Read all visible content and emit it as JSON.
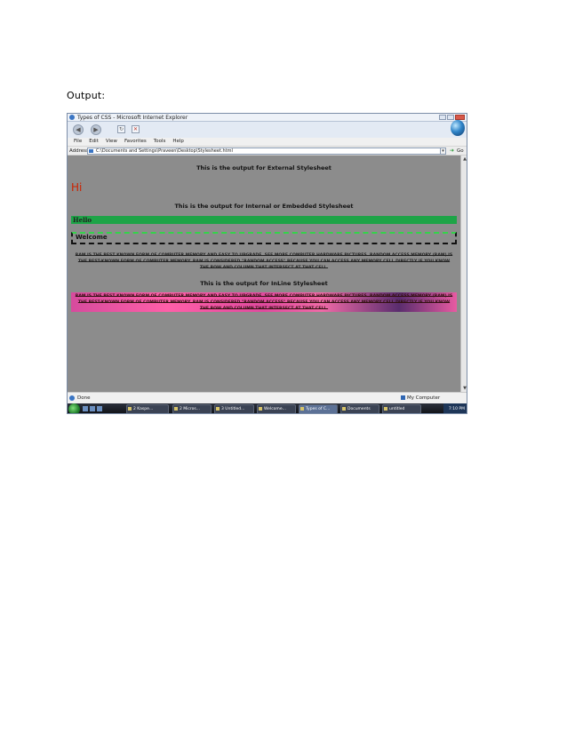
{
  "caption": "Output:",
  "window": {
    "title": "Types of CSS - Microsoft Internet Explorer"
  },
  "menu": [
    "File",
    "Edit",
    "View",
    "Favorites",
    "Tools",
    "Help"
  ],
  "address": {
    "label": "Address",
    "value": "C:\\Documents and Settings\\Praveen\\Desktop\\Stylesheet.html",
    "go": "Go"
  },
  "page": {
    "external_heading": "This is the output for External Stylesheet",
    "hi": "Hi",
    "internal_heading": "This is the output for Internal or Embedded Stylesheet",
    "hello": "Hello",
    "welcome": "Welcome",
    "paragraph": "RAM IS THE BEST KNOWN FORM OF COMPUTER MEMORY AND EASY TO UPGRADE. SEE MORE COMPUTER HARDWARE PICTURES. RANDOM ACCESS MEMORY (RAM) IS THE BEST-KNOWN FORM OF COMPUTER MEMORY. RAM IS CONSIDERED \"RANDOM ACCESS\" BECAUSE YOU CAN ACCESS ANY MEMORY CELL DIRECTLY IF YOU KNOW THE ROW AND COLUMN THAT INTERSECT AT THAT CELL.",
    "inline_heading": "This is the output for InLine Stylesheet",
    "paragraph_inline": "RAM IS THE BEST KNOWN FORM OF COMPUTER MEMORY AND EASY TO UPGRADE. SEE MORE COMPUTER HARDWARE PICTURES. RANDOM ACCESS MEMORY (RAM) IS THE BEST-KNOWN FORM OF COMPUTER MEMORY. RAM IS CONSIDERED \"RANDOM ACCESS\" BECAUSE YOU CAN ACCESS ANY MEMORY CELL DIRECTLY IF YOU KNOW THE ROW AND COLUMN THAT INTERSECT AT THAT CELL."
  },
  "status": {
    "left": "Done",
    "zone": "My Computer"
  },
  "taskbar": {
    "items": [
      "2 Kaspe...",
      "2 Micros...",
      "3 Untitled...",
      "Welcome...",
      "Types of C...",
      "Documents",
      "untitled"
    ],
    "active_index": 4,
    "clock": "7:10 PM"
  },
  "colors": {
    "page_bg": "#8c8c8c",
    "hi_red": "#cc2200",
    "hello_green": "#1da447",
    "pink_gradient": "#ff5fa8"
  }
}
